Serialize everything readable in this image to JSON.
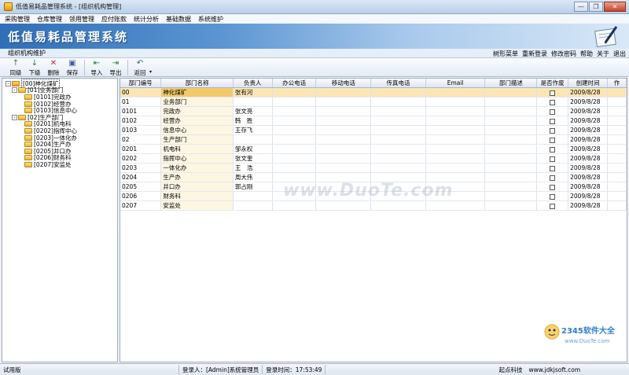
{
  "window": {
    "title": "低值易耗品管理系统 - [组织机构管理]"
  },
  "menu": [
    "采购管理",
    "仓库管理",
    "领用管理",
    "应付账款",
    "统计分析",
    "基础数据",
    "系统维护"
  ],
  "banner": {
    "title": "低值易耗品管理系统"
  },
  "subbar": {
    "page": "组织机构维护",
    "links": [
      "树形菜单",
      "重新登录",
      "修改密码",
      "帮助",
      "关于",
      "退出"
    ]
  },
  "toolbar": {
    "buttons": [
      {
        "label": "同级",
        "icon": "add-sibling-icon"
      },
      {
        "label": "下级",
        "icon": "add-child-icon"
      },
      {
        "label": "删除",
        "icon": "delete-icon"
      },
      {
        "label": "保存",
        "icon": "save-icon"
      },
      {
        "label": "导入",
        "icon": "import-icon"
      },
      {
        "label": "导出",
        "icon": "export-icon"
      },
      {
        "label": "返回",
        "icon": "back-icon"
      }
    ]
  },
  "tree": [
    {
      "label": "[00]神化煤矿",
      "level": 0,
      "expander": "-"
    },
    {
      "label": "[01]业务部门",
      "level": 1,
      "expander": "-"
    },
    {
      "label": "[0101]完政办",
      "level": 2
    },
    {
      "label": "[0102]经营办",
      "level": 2
    },
    {
      "label": "[0103]信息中心",
      "level": 2
    },
    {
      "label": "[02]生产部门",
      "level": 1,
      "expander": "-"
    },
    {
      "label": "[0201]机电科",
      "level": 2
    },
    {
      "label": "[0202]指挥中心",
      "level": 2
    },
    {
      "label": "[0203]一体化办",
      "level": 2
    },
    {
      "label": "[0204]生产办",
      "level": 2
    },
    {
      "label": "[0205]井口办",
      "level": 2
    },
    {
      "label": "[0206]财务科",
      "level": 2
    },
    {
      "label": "[0207]安监处",
      "level": 2
    }
  ],
  "grid": {
    "columns": [
      "部门编号",
      "部门名称",
      "负责人",
      "办公电话",
      "移动电话",
      "传真电话",
      "Email",
      "部门描述",
      "是否作废",
      "创建时间",
      "作"
    ],
    "rows": [
      [
        "00",
        "神化煤矿",
        "张有河",
        "",
        "",
        "",
        "",
        "",
        "",
        "2009/8/28"
      ],
      [
        "01",
        "业务部门",
        "",
        "",
        "",
        "",
        "",
        "",
        "",
        "2009/8/28"
      ],
      [
        "0101",
        "完政办",
        "张文亮",
        "",
        "",
        "",
        "",
        "",
        "",
        "2009/8/28"
      ],
      [
        "0102",
        "经营办",
        "韩　胜",
        "",
        "",
        "",
        "",
        "",
        "",
        "2009/8/28"
      ],
      [
        "0103",
        "信息中心",
        "王存飞",
        "",
        "",
        "",
        "",
        "",
        "",
        "2009/8/28"
      ],
      [
        "02",
        "生产部门",
        "",
        "",
        "",
        "",
        "",
        "",
        "",
        "2009/8/28"
      ],
      [
        "0201",
        "机电科",
        "邹永权",
        "",
        "",
        "",
        "",
        "",
        "",
        "2009/8/28"
      ],
      [
        "0202",
        "指挥中心",
        "张文奎",
        "",
        "",
        "",
        "",
        "",
        "",
        "2009/8/28"
      ],
      [
        "0203",
        "一体化办",
        "王　浩",
        "",
        "",
        "",
        "",
        "",
        "",
        "2009/8/28"
      ],
      [
        "0204",
        "生产办",
        "周大伟",
        "",
        "",
        "",
        "",
        "",
        "",
        "2009/8/28"
      ],
      [
        "0205",
        "井口办",
        "郭占刚",
        "",
        "",
        "",
        "",
        "",
        "",
        "2009/8/28"
      ],
      [
        "0206",
        "财务科",
        "",
        "",
        "",
        "",
        "",
        "",
        "",
        "2009/8/28"
      ],
      [
        "0207",
        "安监处",
        "",
        "",
        "",
        "",
        "",
        "",
        "",
        "2009/8/28"
      ]
    ]
  },
  "watermark": {
    "center": "www.DuoTe.com",
    "brand": "2345软件大全",
    "brand_url": "www.DuoTe.com"
  },
  "status": {
    "edition": "试用版",
    "user": "登录人：[Admin]系统管理员",
    "time": "登录时间：17:53:49",
    "company": "起点科技",
    "site": "www.jdkjsoft.com"
  }
}
